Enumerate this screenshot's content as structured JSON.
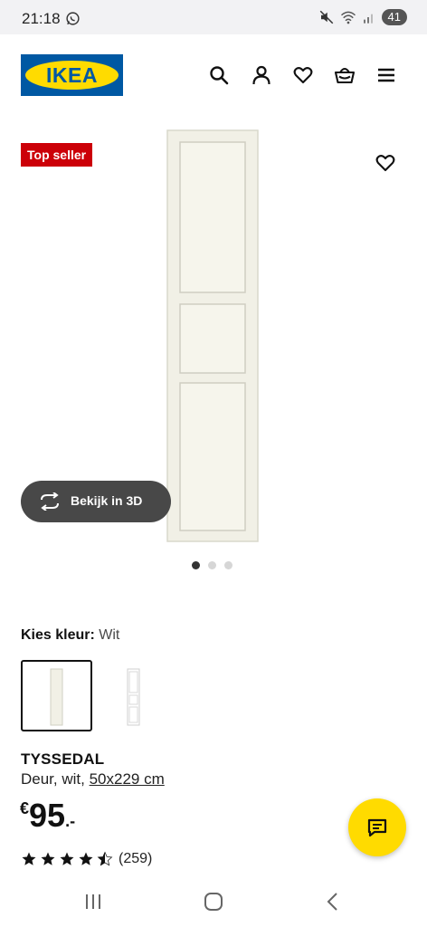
{
  "status_bar": {
    "time": "21:18",
    "battery": "41",
    "icons": [
      "whatsapp-icon",
      "mute-icon",
      "wifi-icon",
      "signal-icon"
    ]
  },
  "header": {
    "logo_text": "IKEA",
    "icons": [
      "search-icon",
      "account-icon",
      "wishlist-icon",
      "basket-icon",
      "menu-icon"
    ]
  },
  "hero": {
    "badge": "Top seller",
    "view_3d_label": "Bekijk in 3D",
    "image_count": 3,
    "active_image": 1
  },
  "color_choice": {
    "label": "Kies kleur:",
    "value": "Wit"
  },
  "product": {
    "name": "TYSSEDAL",
    "description": "Deur, wit,",
    "size": "50x229 cm",
    "price_currency": "€",
    "price_int": "95",
    "price_dec": ".-",
    "rating": 4.5,
    "rating_max": 5,
    "review_count": "(259)"
  },
  "nav": {
    "buttons": [
      "recent-apps-icon",
      "home-icon",
      "back-icon"
    ]
  },
  "colors": {
    "ikea_blue": "#0058a3",
    "ikea_yellow": "#ffdb00",
    "badge_red": "#cc0008",
    "button_dark": "#484848"
  }
}
